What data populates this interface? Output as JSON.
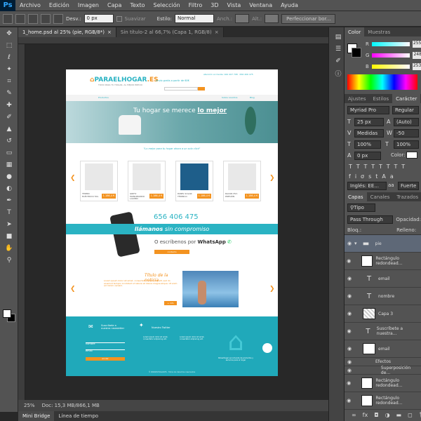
{
  "menubar": {
    "app_logo": "Ps",
    "items": [
      "Archivo",
      "Edición",
      "Imagen",
      "Capa",
      "Texto",
      "Selección",
      "Filtro",
      "3D",
      "Vista",
      "Ventana",
      "Ayuda"
    ]
  },
  "options": {
    "desv_label": "Desv.:",
    "desv_value": "0 px",
    "suavizar": "Suavizar",
    "estilo_label": "Estilo:",
    "estilo_value": "Normal",
    "anch_label": "Anch.:",
    "alt_label": "Alt.:",
    "perfeccionar": "Perfeccionar bor..."
  },
  "doc_tabs": [
    {
      "label": "1_home.psd al 25% (pie, RGB/8*)",
      "close": "×"
    },
    {
      "label": "Sin título-2 al 66,7% (Capa 1, RGB/8)",
      "close": "×"
    }
  ],
  "status": {
    "zoom": "25%",
    "doc_info": "Doc: 15,3 MB/866,1 MB"
  },
  "bottom_tabs": [
    "Mini Bridge",
    "Línea de tiempo"
  ],
  "colors": {
    "accent": "#2ab3c3",
    "orange": "#f39320"
  },
  "color_panel": {
    "tabs": [
      "Color",
      "Muestras"
    ],
    "r": "255",
    "g": "248",
    "b": "253",
    "r_label": "R",
    "g_label": "G",
    "b_label": "B"
  },
  "char_panel": {
    "tabs": [
      "Ajustes",
      "Estilos",
      "Carácter"
    ],
    "font": "Myriad Pro",
    "style": "Regular",
    "size": "25 px",
    "leading": "(Auto)",
    "kerning": "Medidas",
    "tracking": "-50",
    "vscale": "100%",
    "hscale": "100%",
    "baseline": "0 px",
    "color_label": "Color:",
    "lang": "Inglés: EE...",
    "aa": "Fuerte",
    "aa_icon": "aa"
  },
  "layers_panel": {
    "tabs": [
      "Capas",
      "Canales",
      "Trazados"
    ],
    "kind": "Tipo",
    "blend": "Pass Through",
    "opacity_label": "Opacidad:",
    "lock_label": "Bloq.:",
    "fill_label": "Relleno:",
    "layers": [
      {
        "name": "pie",
        "thumb": "folder"
      },
      {
        "name": "Rectángulo redondead...",
        "thumb": "shape"
      },
      {
        "name": "email",
        "thumb": "T"
      },
      {
        "name": "nombre",
        "thumb": "T"
      },
      {
        "name": "Capa 3",
        "thumb": "shape"
      },
      {
        "name": "Suscríbete a nuestra...",
        "thumb": "T"
      },
      {
        "name": "email",
        "thumb": "shape"
      },
      {
        "name": "Efectos",
        "thumb": "none"
      },
      {
        "name": "Superposición de...",
        "thumb": "none"
      },
      {
        "name": "Rectángulo redondead...",
        "thumb": "shape"
      },
      {
        "name": "Rectángulo redondead...",
        "thumb": "shape"
      }
    ]
  },
  "site": {
    "logo_main": "PARAELHOGAR",
    "logo_tld": ".ES",
    "logo_sub": "TODO PARA TU HOGAR, AL MEJOR PRECIO",
    "shipping": "envío gratis a partir de 60€",
    "contact": "atención al cliente: 944 407 708 · 656 406 475",
    "nav_products": "Productos",
    "nav_about": "Sobre nosotros",
    "nav_blog": "Blog",
    "hero_title_pre": "Tu hogar se merece",
    "hero_title_bold": "lo mejor",
    "quote": "\"Lo mejor para tu hogar ahora a un solo click\"",
    "products": [
      {
        "name": "TERMO ELÉCTRICO 50L",
        "price": "1.186,4 €"
      },
      {
        "name": "GRIFO MONOMANDO LAVABO",
        "price": "1.186,4 €"
      },
      {
        "name": "PANEL SOLAR TÉRMICO",
        "price": "1.186,4 €"
      },
      {
        "name": "RACOR PVC PRESIÓN",
        "price": "1.186,4 €"
      }
    ],
    "arrow_left": "❮",
    "arrow_right": "❯",
    "phone": "656 406 475",
    "call_bold": "llámanos",
    "call_rest": "sin compromiso",
    "wa_pre": "O escríbenos por",
    "wa_bold": "WhatsApp",
    "contact_btn": "contacto",
    "news_title": "Título de la noticia",
    "news_text": "Lorem ipsum dolor sit amet, consectetur adipiscing elit, sed do eiusmod tempor incididunt ut labore et dolore magna aliqua. Ut enim ad minim veniam.",
    "news_btn": "+ info",
    "newsletter_title": "Suscríbete a nuestra newsletter",
    "nombre": "nombre",
    "email": "email",
    "newsletter_btn": "enviar",
    "twitter_title": "Nuestro Twitter",
    "footer_text": "Lorem ipsum dolor sit amet, consectetur adipiscing elit.",
    "footer_text2": "Lorem ipsum dolor sit amet, consectetur adipiscing elit.",
    "footer_brand": "Paraelhogar es la tienda de productos y servicios para el hogar",
    "house_icon": "⌂",
    "copyright": "© PARAELHOGAR.ES · Todos los derechos reservados"
  }
}
